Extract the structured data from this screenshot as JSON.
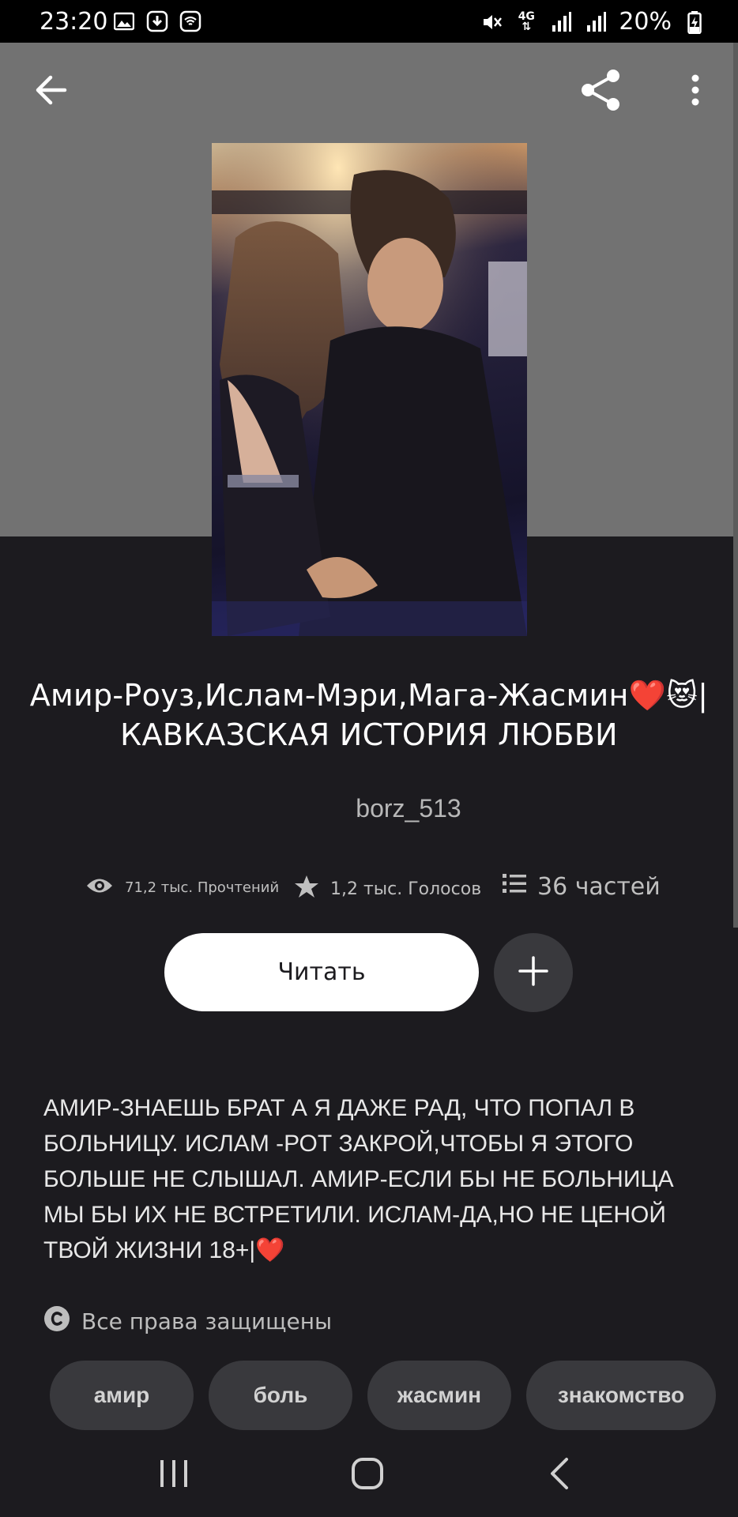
{
  "status_bar": {
    "time": "23:20",
    "battery": "20%",
    "network": "4G",
    "icons_left": [
      "gallery-icon",
      "download-icon",
      "wifi-calling-icon"
    ],
    "icons_right": [
      "mute-icon",
      "network-4g-icon",
      "signal-icon",
      "signal-icon",
      "battery-charging-icon"
    ]
  },
  "top_bar": {
    "back_icon": "arrow-left-icon",
    "share_icon": "share-icon",
    "menu_icon": "more-vert-icon"
  },
  "story": {
    "title": "Амир-Роуз,Ислам-Мэри,Мага-Жасмин❤️😻| КАВКАЗСКАЯ ИСТОРИЯ ЛЮБВИ",
    "author": "borz_513",
    "stats": {
      "reads": "71,2 тыс. Прочтений",
      "votes": "1,2 тыс. Голосов",
      "parts": "36 частей"
    },
    "description": "АМИР-ЗНАЕШЬ БРАТ А Я ДАЖЕ РАД, ЧТО ПОПАЛ В БОЛЬНИЦУ. ИСЛАМ -РОТ ЗАКРОЙ,ЧТОБЫ Я ЭТОГО БОЛЬШЕ НЕ СЛЫШАЛ. АМИР-ЕСЛИ БЫ НЕ БОЛЬНИЦА МЫ БЫ ИХ НЕ ВСТРЕТИЛИ. ИСЛАМ-ДА,НО НЕ ЦЕНОЙ ТВОЙ ЖИЗНИ 18+|❤️",
    "copyright": "Все права защищены",
    "tags": [
      "амир",
      "боль",
      "жасмин",
      "знакомство"
    ]
  },
  "actions": {
    "read_label": "Читать",
    "add_icon": "plus-icon"
  },
  "colors": {
    "background": "#1c1b1f",
    "header_band": "#727272",
    "button_bg": "#ffffff",
    "chip_bg": "#39393d"
  }
}
